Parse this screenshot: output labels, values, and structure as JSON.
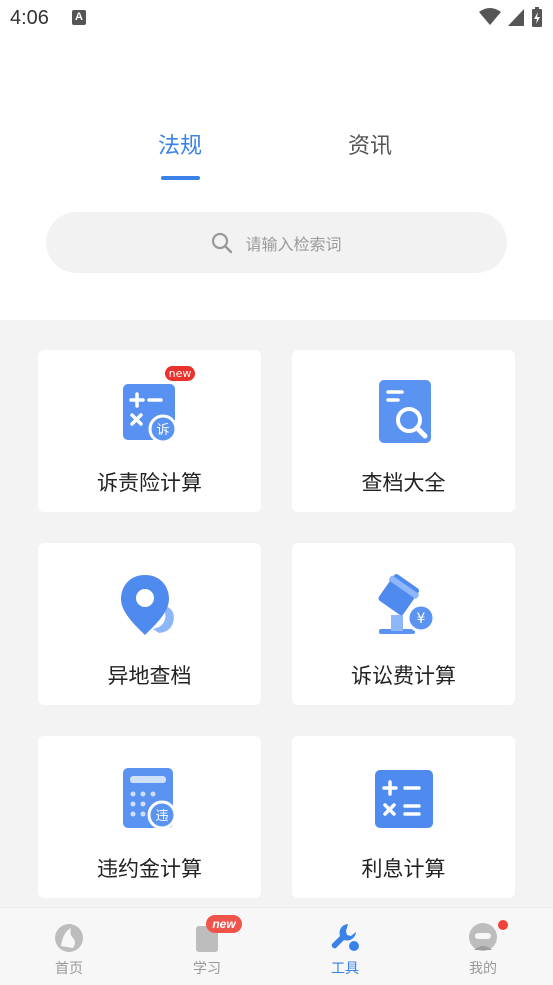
{
  "status_bar": {
    "time": "4:06",
    "notification_icon": "A"
  },
  "tabs": {
    "items": [
      {
        "label": "法规",
        "active": true
      },
      {
        "label": "资讯",
        "active": false
      }
    ]
  },
  "search": {
    "placeholder": "请输入检索词"
  },
  "tools": {
    "items": [
      {
        "label": "诉责险计算",
        "icon": "calculator-su-icon",
        "badge": "new"
      },
      {
        "label": "查档大全",
        "icon": "document-search-icon"
      },
      {
        "label": "异地查档",
        "icon": "location-pin-icon"
      },
      {
        "label": "诉讼费计算",
        "icon": "gavel-yuan-icon"
      },
      {
        "label": "违约金计算",
        "icon": "calculator-wei-icon"
      },
      {
        "label": "利息计算",
        "icon": "calculator-icon"
      }
    ]
  },
  "bottom_nav": {
    "items": [
      {
        "label": "首页",
        "icon": "home-icon",
        "active": false
      },
      {
        "label": "学习",
        "icon": "book-icon",
        "active": false,
        "badge": "new"
      },
      {
        "label": "工具",
        "icon": "wrench-icon",
        "active": true
      },
      {
        "label": "我的",
        "icon": "profile-icon",
        "active": false,
        "dot": true
      }
    ]
  },
  "colors": {
    "accent": "#3B82E8",
    "badge_red": "#E8322B",
    "grid_bg": "#F3F3F3"
  }
}
